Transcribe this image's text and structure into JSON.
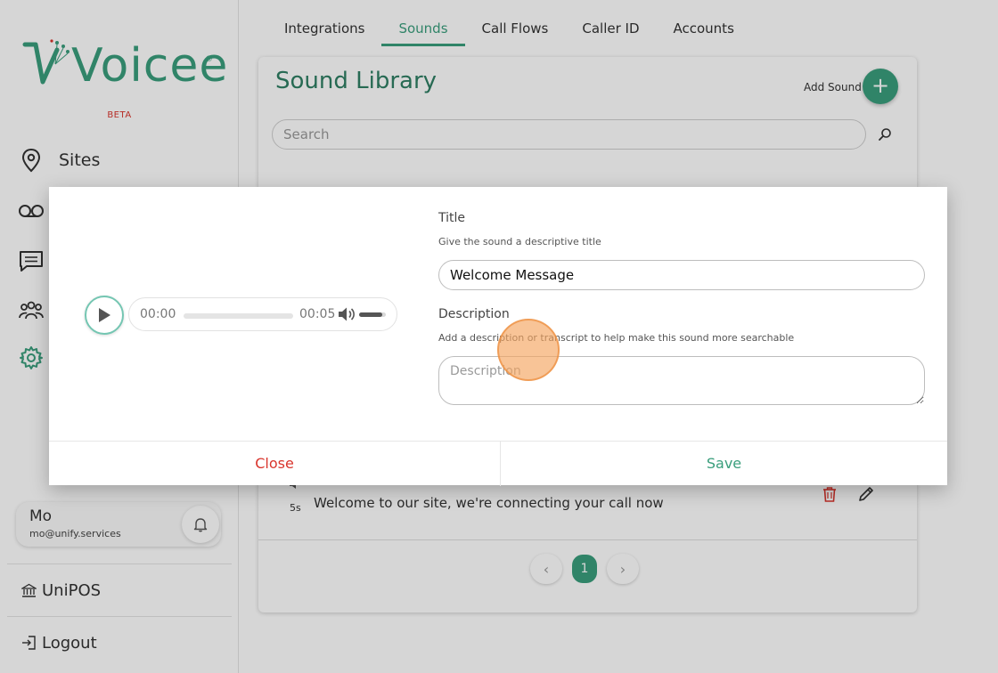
{
  "brand": {
    "logo_text": "Voicee",
    "reg_mark": "®",
    "beta": "BETA",
    "accent": "#3a9e7c",
    "danger": "#d9352d"
  },
  "sidebar": {
    "items": [
      {
        "label": "Sites",
        "icon": "map-pin-icon"
      },
      {
        "label": "",
        "icon": "voicemail-icon"
      },
      {
        "label": "",
        "icon": "message-icon"
      },
      {
        "label": "",
        "icon": "users-icon"
      },
      {
        "label": "",
        "icon": "gear-icon"
      }
    ],
    "user": {
      "name": "Mo",
      "email": "mo@unify.services"
    },
    "links": [
      {
        "label": "UniPOS",
        "icon": "bank-icon"
      },
      {
        "label": "Logout",
        "icon": "logout-icon"
      }
    ]
  },
  "tabs": [
    {
      "label": "Integrations",
      "active": false
    },
    {
      "label": "Sounds",
      "active": true
    },
    {
      "label": "Call Flows",
      "active": false
    },
    {
      "label": "Caller ID",
      "active": false
    },
    {
      "label": "Accounts",
      "active": false
    }
  ],
  "library": {
    "title": "Sound Library",
    "add_label": "Add Sound",
    "add_symbol": "+",
    "search_placeholder": "Search",
    "row": {
      "duration": "5s",
      "text": "Welcome to our site, we're connecting your call now"
    },
    "pager": {
      "prev": "‹",
      "current": "1",
      "next": "›"
    }
  },
  "modal": {
    "player": {
      "current_time": "00:00",
      "duration": "00:05",
      "progress": 0,
      "volume": 0.85
    },
    "title_label": "Title",
    "title_help": "Give the sound a descriptive title",
    "title_value": "Welcome Message",
    "desc_label": "Description",
    "desc_help": "Add a description or transcript to help make this sound more searchable",
    "desc_placeholder": "Description",
    "close_label": "Close",
    "save_label": "Save"
  }
}
